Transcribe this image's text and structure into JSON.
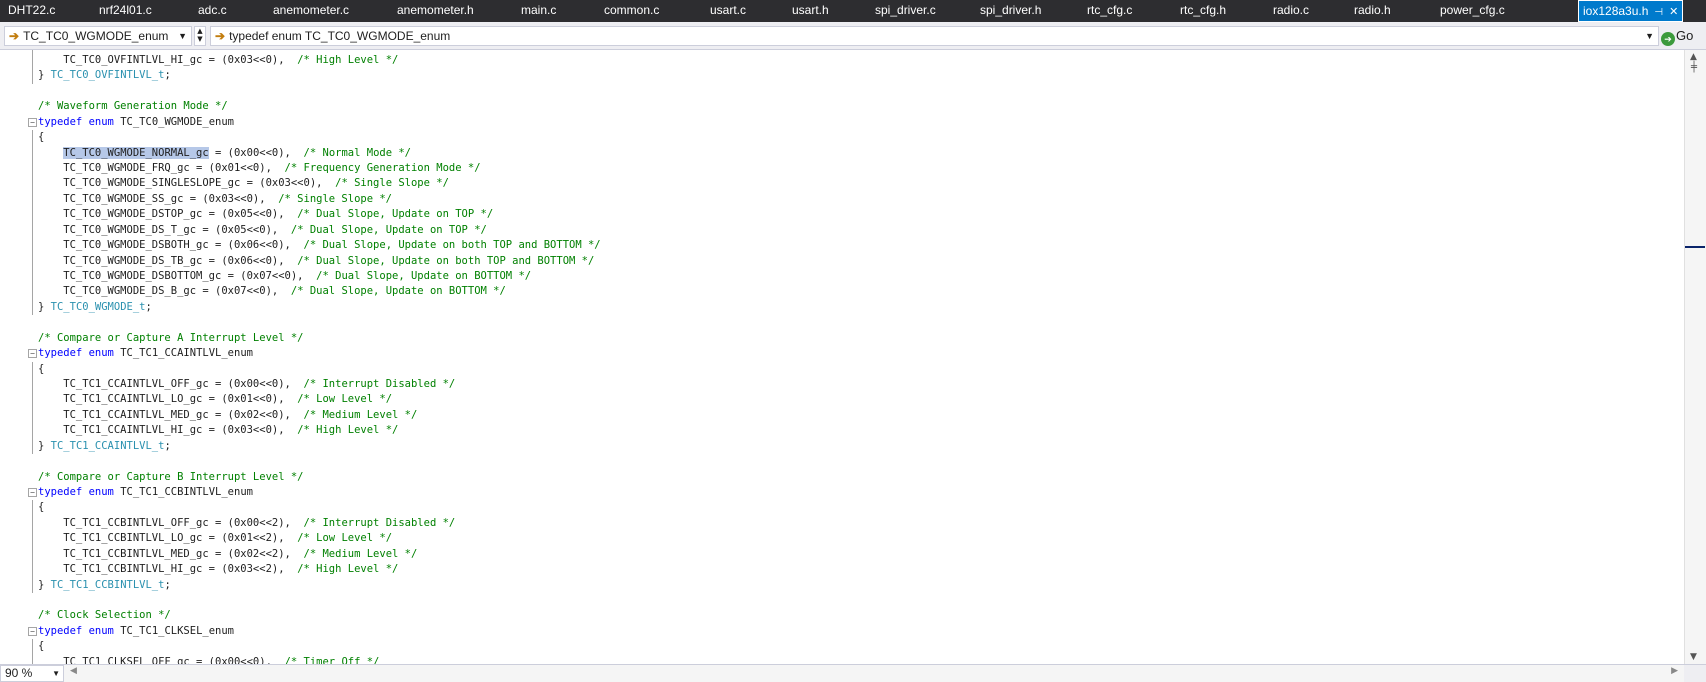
{
  "tabs": [
    {
      "label": "DHT22.c"
    },
    {
      "label": "nrf24l01.c"
    },
    {
      "label": "adc.c"
    },
    {
      "label": "anemometer.c"
    },
    {
      "label": "anemometer.h"
    },
    {
      "label": "main.c"
    },
    {
      "label": "common.c"
    },
    {
      "label": "usart.c"
    },
    {
      "label": "usart.h"
    },
    {
      "label": "spi_driver.c"
    },
    {
      "label": "spi_driver.h"
    },
    {
      "label": "rtc_cfg.c"
    },
    {
      "label": "rtc_cfg.h"
    },
    {
      "label": "radio.c"
    },
    {
      "label": "radio.h"
    },
    {
      "label": "power_cfg.c"
    }
  ],
  "active_tab": {
    "label": "iox128a3u.h",
    "pin_icon": "pin-icon",
    "close_icon": "close-icon"
  },
  "navbar": {
    "type_scope": "TC_TC0_WGMODE_enum",
    "member_scope": "typedef enum TC_TC0_WGMODE_enum",
    "go_label": "Go"
  },
  "editor": {
    "highlighted_token": "TC_TC0_WGMODE_NORMAL_gc",
    "lines": [
      [
        {
          "t": "    TC_TC0_OVFINTLVL_HI_gc = (0x03<<0),  ",
          "c": ""
        },
        {
          "t": "/* High Level */",
          "c": "cm"
        }
      ],
      [
        {
          "t": "} ",
          "c": ""
        },
        {
          "t": "TC_TC0_OVFINTLVL_t",
          "c": "ty"
        },
        {
          "t": ";",
          "c": ""
        }
      ],
      [],
      [
        {
          "t": "/* Waveform Generation Mode */",
          "c": "cm"
        }
      ],
      [
        {
          "t": "typedef",
          "c": "kw"
        },
        {
          "t": " ",
          "c": ""
        },
        {
          "t": "enum",
          "c": "kw"
        },
        {
          "t": " TC_TC0_WGMODE_enum",
          "c": ""
        }
      ],
      [
        {
          "t": "{",
          "c": ""
        }
      ],
      [
        {
          "t": "    ",
          "c": ""
        },
        {
          "t": "TC_TC0_WGMODE_NORMAL_gc",
          "c": "hl"
        },
        {
          "t": " = (0x00<<0),  ",
          "c": ""
        },
        {
          "t": "/* Normal Mode */",
          "c": "cm"
        }
      ],
      [
        {
          "t": "    TC_TC0_WGMODE_FRQ_gc = (0x01<<0),  ",
          "c": ""
        },
        {
          "t": "/* Frequency Generation Mode */",
          "c": "cm"
        }
      ],
      [
        {
          "t": "    TC_TC0_WGMODE_SINGLESLOPE_gc = (0x03<<0),  ",
          "c": ""
        },
        {
          "t": "/* Single Slope */",
          "c": "cm"
        }
      ],
      [
        {
          "t": "    TC_TC0_WGMODE_SS_gc = (0x03<<0),  ",
          "c": ""
        },
        {
          "t": "/* Single Slope */",
          "c": "cm"
        }
      ],
      [
        {
          "t": "    TC_TC0_WGMODE_DSTOP_gc = (0x05<<0),  ",
          "c": ""
        },
        {
          "t": "/* Dual Slope, Update on TOP */",
          "c": "cm"
        }
      ],
      [
        {
          "t": "    TC_TC0_WGMODE_DS_T_gc = (0x05<<0),  ",
          "c": ""
        },
        {
          "t": "/* Dual Slope, Update on TOP */",
          "c": "cm"
        }
      ],
      [
        {
          "t": "    TC_TC0_WGMODE_DSBOTH_gc = (0x06<<0),  ",
          "c": ""
        },
        {
          "t": "/* Dual Slope, Update on both TOP and BOTTOM */",
          "c": "cm"
        }
      ],
      [
        {
          "t": "    TC_TC0_WGMODE_DS_TB_gc = (0x06<<0),  ",
          "c": ""
        },
        {
          "t": "/* Dual Slope, Update on both TOP and BOTTOM */",
          "c": "cm"
        }
      ],
      [
        {
          "t": "    TC_TC0_WGMODE_DSBOTTOM_gc = (0x07<<0),  ",
          "c": ""
        },
        {
          "t": "/* Dual Slope, Update on BOTTOM */",
          "c": "cm"
        }
      ],
      [
        {
          "t": "    TC_TC0_WGMODE_DS_B_gc = (0x07<<0),  ",
          "c": ""
        },
        {
          "t": "/* Dual Slope, Update on BOTTOM */",
          "c": "cm"
        }
      ],
      [
        {
          "t": "} ",
          "c": ""
        },
        {
          "t": "TC_TC0_WGMODE_t",
          "c": "ty"
        },
        {
          "t": ";",
          "c": ""
        }
      ],
      [],
      [
        {
          "t": "/* Compare or Capture A Interrupt Level */",
          "c": "cm"
        }
      ],
      [
        {
          "t": "typedef",
          "c": "kw"
        },
        {
          "t": " ",
          "c": ""
        },
        {
          "t": "enum",
          "c": "kw"
        },
        {
          "t": " TC_TC1_CCAINTLVL_enum",
          "c": ""
        }
      ],
      [
        {
          "t": "{",
          "c": ""
        }
      ],
      [
        {
          "t": "    TC_TC1_CCAINTLVL_OFF_gc = (0x00<<0),  ",
          "c": ""
        },
        {
          "t": "/* Interrupt Disabled */",
          "c": "cm"
        }
      ],
      [
        {
          "t": "    TC_TC1_CCAINTLVL_LO_gc = (0x01<<0),  ",
          "c": ""
        },
        {
          "t": "/* Low Level */",
          "c": "cm"
        }
      ],
      [
        {
          "t": "    TC_TC1_CCAINTLVL_MED_gc = (0x02<<0),  ",
          "c": ""
        },
        {
          "t": "/* Medium Level */",
          "c": "cm"
        }
      ],
      [
        {
          "t": "    TC_TC1_CCAINTLVL_HI_gc = (0x03<<0),  ",
          "c": ""
        },
        {
          "t": "/* High Level */",
          "c": "cm"
        }
      ],
      [
        {
          "t": "} ",
          "c": ""
        },
        {
          "t": "TC_TC1_CCAINTLVL_t",
          "c": "ty"
        },
        {
          "t": ";",
          "c": ""
        }
      ],
      [],
      [
        {
          "t": "/* Compare or Capture B Interrupt Level */",
          "c": "cm"
        }
      ],
      [
        {
          "t": "typedef",
          "c": "kw"
        },
        {
          "t": " ",
          "c": ""
        },
        {
          "t": "enum",
          "c": "kw"
        },
        {
          "t": " TC_TC1_CCBINTLVL_enum",
          "c": ""
        }
      ],
      [
        {
          "t": "{",
          "c": ""
        }
      ],
      [
        {
          "t": "    TC_TC1_CCBINTLVL_OFF_gc = (0x00<<2),  ",
          "c": ""
        },
        {
          "t": "/* Interrupt Disabled */",
          "c": "cm"
        }
      ],
      [
        {
          "t": "    TC_TC1_CCBINTLVL_LO_gc = (0x01<<2),  ",
          "c": ""
        },
        {
          "t": "/* Low Level */",
          "c": "cm"
        }
      ],
      [
        {
          "t": "    TC_TC1_CCBINTLVL_MED_gc = (0x02<<2),  ",
          "c": ""
        },
        {
          "t": "/* Medium Level */",
          "c": "cm"
        }
      ],
      [
        {
          "t": "    TC_TC1_CCBINTLVL_HI_gc = (0x03<<2),  ",
          "c": ""
        },
        {
          "t": "/* High Level */",
          "c": "cm"
        }
      ],
      [
        {
          "t": "} ",
          "c": ""
        },
        {
          "t": "TC_TC1_CCBINTLVL_t",
          "c": "ty"
        },
        {
          "t": ";",
          "c": ""
        }
      ],
      [],
      [
        {
          "t": "/* Clock Selection */",
          "c": "cm"
        }
      ],
      [
        {
          "t": "typedef",
          "c": "kw"
        },
        {
          "t": " ",
          "c": ""
        },
        {
          "t": "enum",
          "c": "kw"
        },
        {
          "t": " TC_TC1_CLKSEL_enum",
          "c": ""
        }
      ],
      [
        {
          "t": "{",
          "c": ""
        }
      ],
      [
        {
          "t": "    TC_TC1_CLKSEL_OFF_gc = (0x00<<0),  ",
          "c": ""
        },
        {
          "t": "/* Timer Off */",
          "c": "cm"
        }
      ]
    ]
  },
  "zoom": {
    "value": "90 %"
  },
  "colors": {
    "tabbar_bg": "#2d2d30",
    "active_tab_bg": "#007acc",
    "keyword": "#0000ff",
    "type": "#2b91af",
    "comment": "#008000",
    "selection": "#b6c8e8"
  }
}
